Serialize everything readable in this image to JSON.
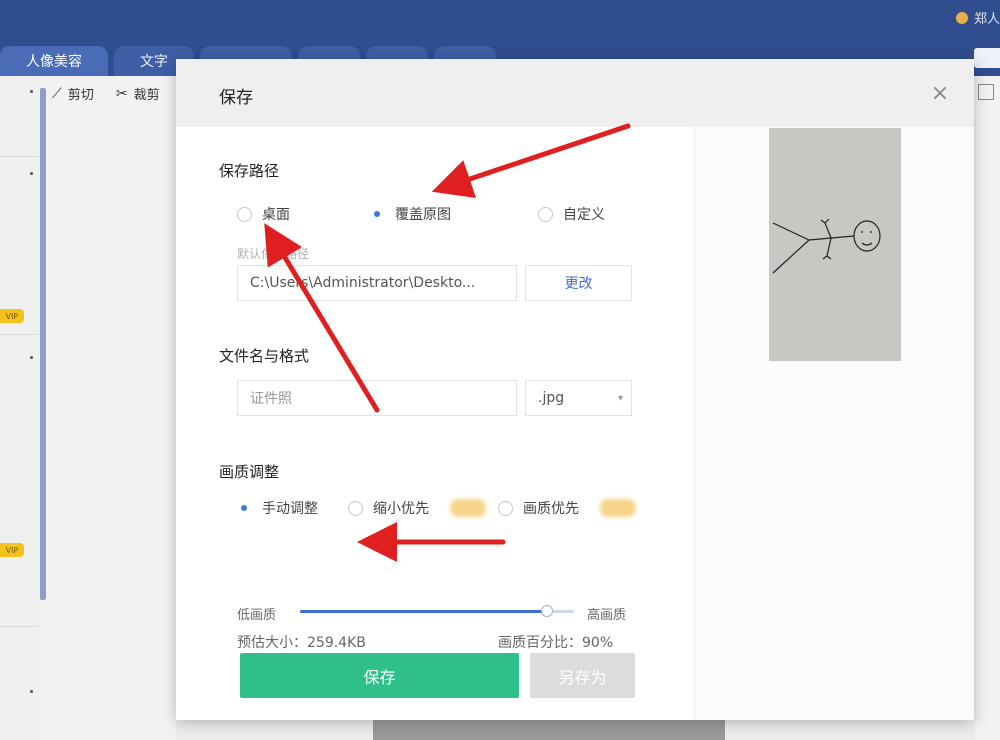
{
  "app": {
    "user_label": "郑人",
    "tabs": [
      {
        "label": "人像美容",
        "active": true
      },
      {
        "label": "文字",
        "active": false
      },
      {
        "label": "",
        "active": false
      },
      {
        "label": "",
        "active": false
      },
      {
        "label": "",
        "active": false
      },
      {
        "label": "",
        "active": false
      }
    ],
    "toolbar": [
      {
        "icon": "pencil-icon",
        "label": "剪切"
      },
      {
        "icon": "scissors-icon",
        "label": "裁剪"
      }
    ],
    "left_badges": [
      "VIP",
      "VIP"
    ]
  },
  "dialog": {
    "title": "保存",
    "close_icon": "close-icon",
    "save_path": {
      "title": "保存路径",
      "options": [
        {
          "label": "桌面",
          "checked": false
        },
        {
          "label": "覆盖原图",
          "checked": true
        },
        {
          "label": "自定义",
          "checked": false
        }
      ],
      "default_path_label": "默认保存路径",
      "path_value": "C:\\Users\\Administrator\\Deskto...",
      "change_label": "更改"
    },
    "filename": {
      "title": "文件名与格式",
      "placeholder": "证件照",
      "format_value": ".jpg"
    },
    "quality": {
      "title": "画质调整",
      "options": [
        {
          "label": "手动调整",
          "checked": true
        },
        {
          "label": "缩小优先",
          "checked": false
        },
        {
          "label": "画质优先",
          "checked": false
        }
      ],
      "low_label": "低画质",
      "high_label": "高画质",
      "slider_percent": 90,
      "size_text": "预估大小：259.4KB",
      "percent_text": "画质百分比：90%"
    },
    "buttons": {
      "save": "保存",
      "save_as": "另存为"
    }
  },
  "colors": {
    "topbar": "#2f4d8f",
    "primary_button": "#2fbf8a",
    "accent_blue": "#3a78e0",
    "annotation_arrow": "#e02020"
  }
}
